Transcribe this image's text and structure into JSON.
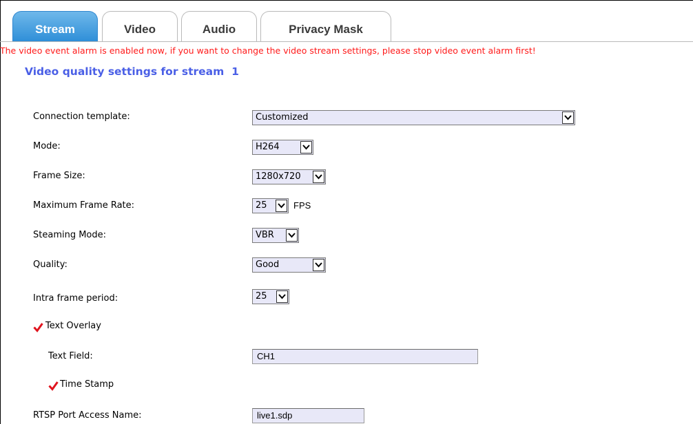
{
  "tabs": [
    {
      "label": "Stream",
      "active": true
    },
    {
      "label": "Video",
      "active": false
    },
    {
      "label": "Audio",
      "active": false
    },
    {
      "label": "Privacy Mask",
      "active": false
    }
  ],
  "alarm_message": "The video event alarm is enabled now, if you want to change the video stream settings, please stop video event alarm first!",
  "section": {
    "title": "Video quality settings for stream",
    "stream_number": "1"
  },
  "fields": {
    "connection_template": {
      "label": "Connection template:",
      "value": "Customized"
    },
    "mode": {
      "label": "Mode:",
      "value": "H264"
    },
    "frame_size": {
      "label": "Frame Size:",
      "value": "1280x720"
    },
    "max_frame_rate": {
      "label": "Maximum Frame Rate:",
      "value": "25",
      "unit": "FPS"
    },
    "streaming_mode": {
      "label": "Steaming Mode:",
      "value": "VBR"
    },
    "quality": {
      "label": "Quality:",
      "value": "Good"
    },
    "intra_frame_period": {
      "label": "Intra frame period:",
      "value": "25"
    },
    "text_overlay": {
      "label": "Text Overlay",
      "checked": true
    },
    "text_field": {
      "label": "Text Field:",
      "value": "CH1"
    },
    "time_stamp": {
      "label": "Time Stamp",
      "checked": true
    },
    "rtsp_access_name": {
      "label": "RTSP Port Access Name:",
      "value": "live1.sdp"
    }
  },
  "colors": {
    "tab_active": "#2f8fd8",
    "alarm_text": "#ff1a1a",
    "section_title": "#4a5fe6",
    "checkmark": "#e0141e"
  },
  "icons": {
    "dropdown": "chevron-down-icon",
    "checkbox": "checkmark-icon"
  }
}
